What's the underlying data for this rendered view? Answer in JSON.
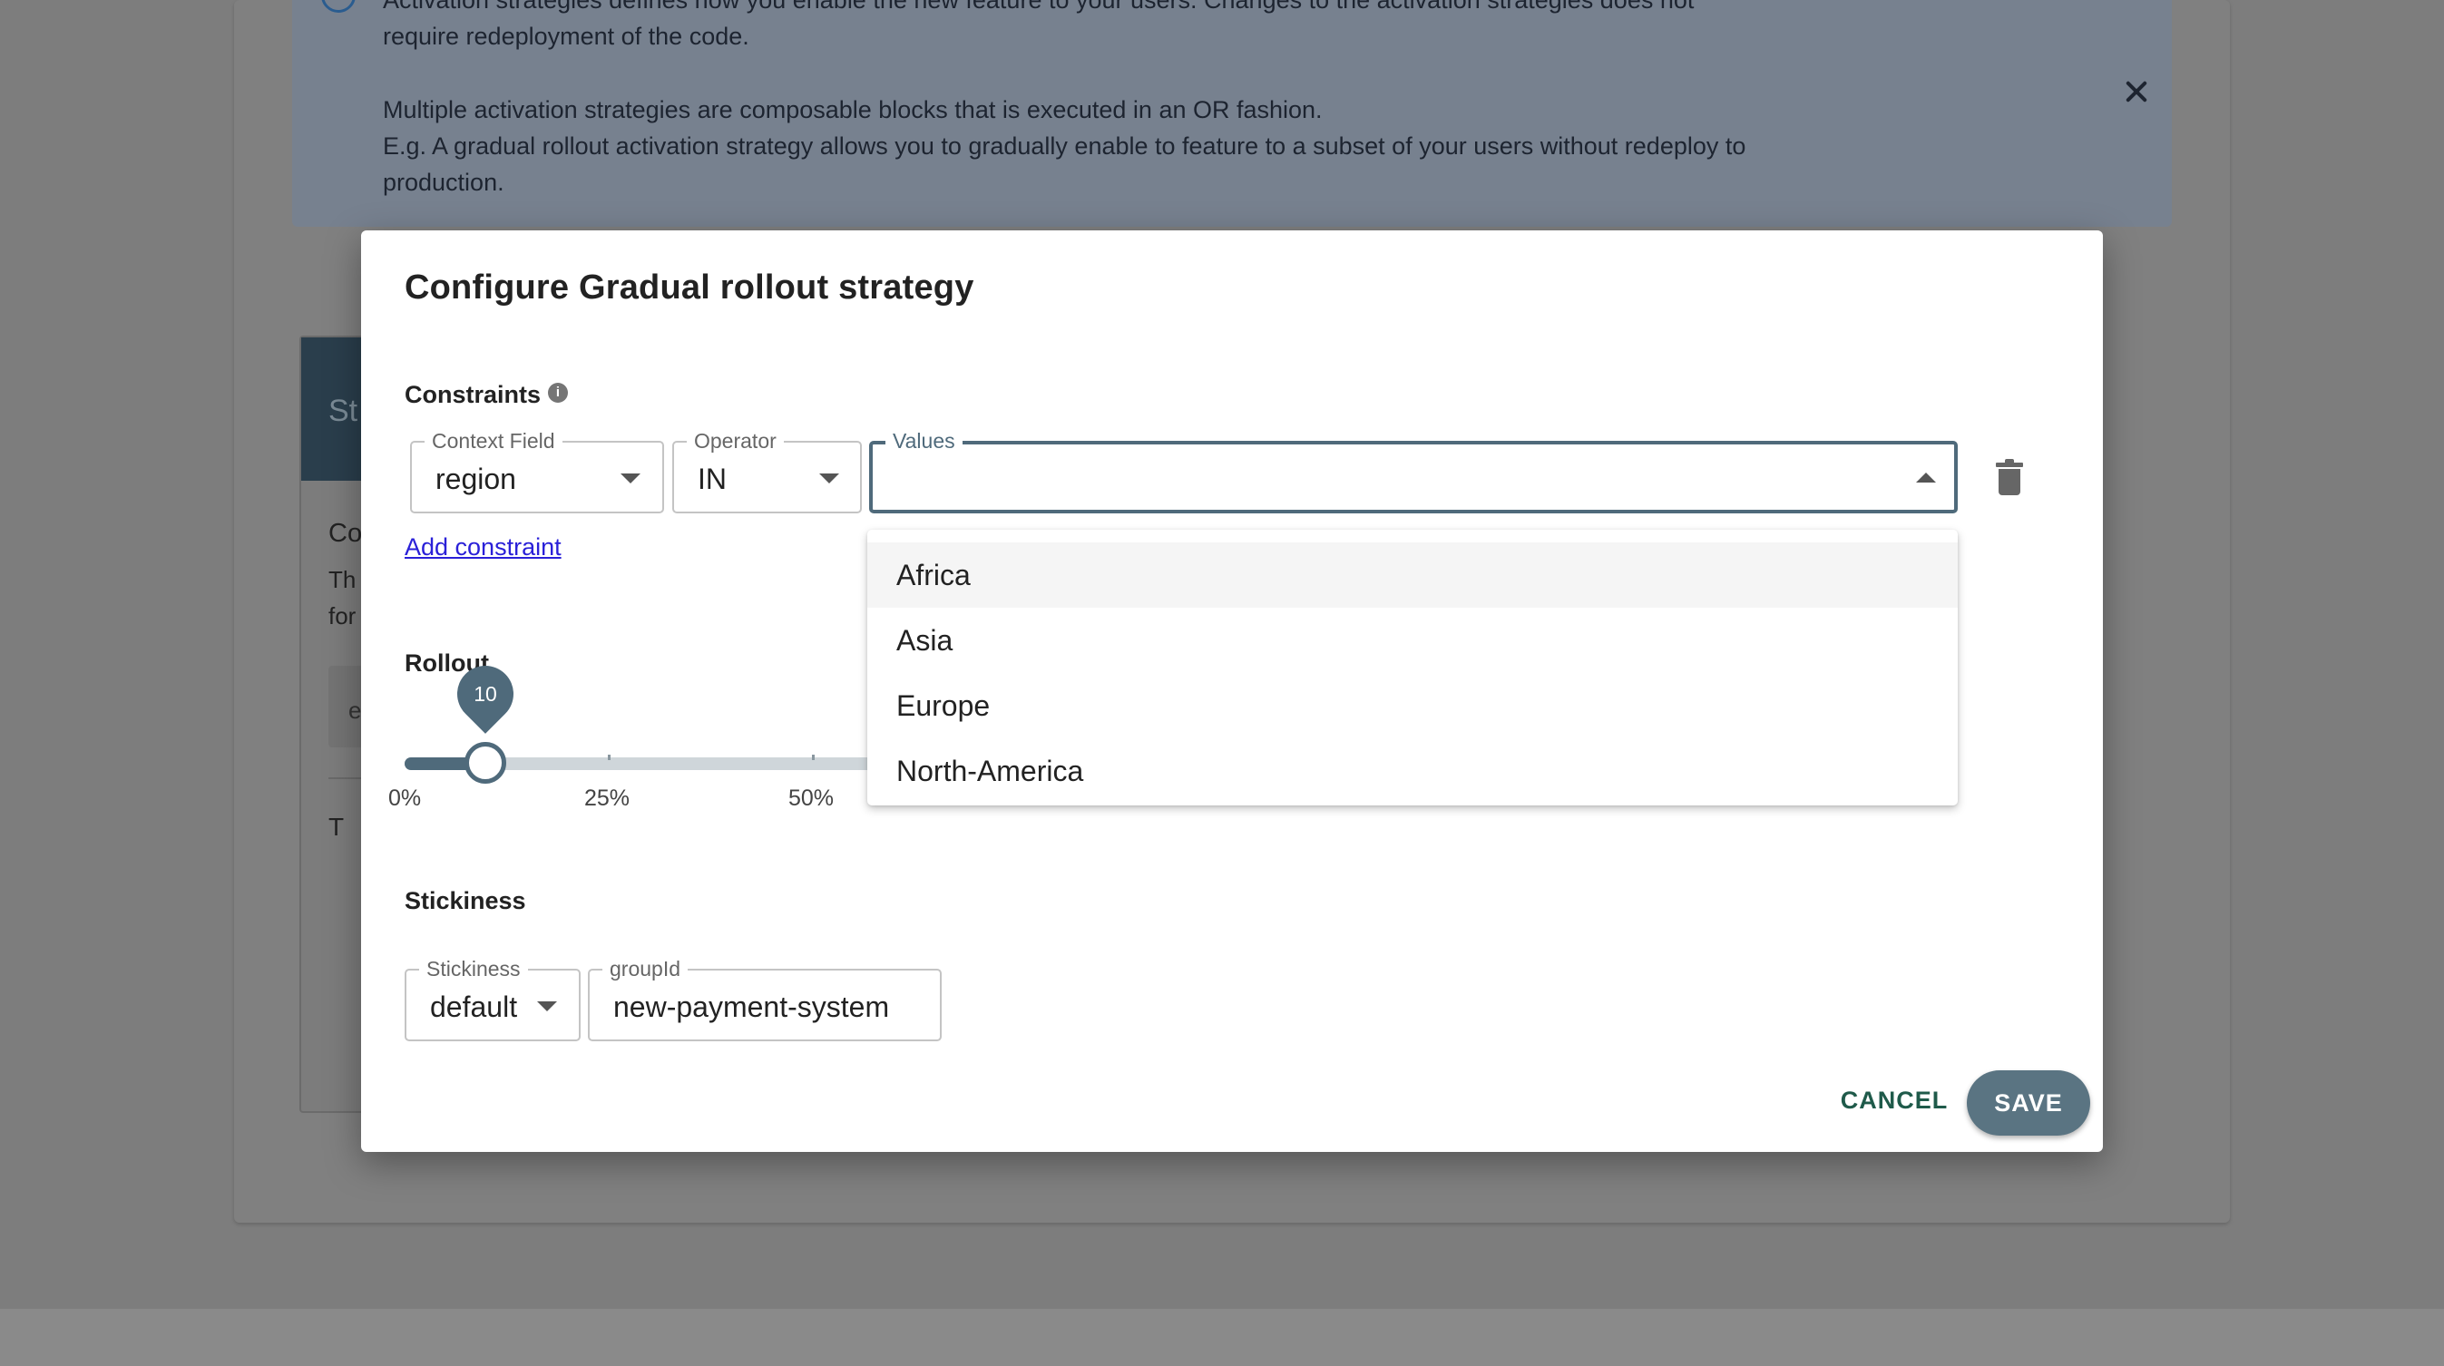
{
  "background": {
    "alert": {
      "line1": "Activation strategies defines how you enable the new feature to your users. Changes to the activation strategies does not",
      "line2": "require redeployment of the code.",
      "line3": "Multiple activation strategies are composable blocks that is executed in an OR fashion.",
      "line4": "E.g. A gradual rollout activation strategy allows you to gradually enable to feature to a subset of your users without redeploy to",
      "line5": "production."
    },
    "strategy_card": {
      "header_partial": "St",
      "title_partial": "Co",
      "text_partial_1": "Th",
      "text_partial_2": "for",
      "input_partial": "e",
      "footer_partial": "T"
    }
  },
  "modal": {
    "title": "Configure Gradual rollout strategy",
    "constraints": {
      "label": "Constraints",
      "help_icon": "i",
      "context_field": {
        "legend": "Context Field",
        "value": "region"
      },
      "operator": {
        "legend": "Operator",
        "value": "IN"
      },
      "values": {
        "legend": "Values",
        "value": ""
      },
      "add_constraint": "Add constraint",
      "options": [
        "Africa",
        "Asia",
        "Europe",
        "North-America"
      ]
    },
    "rollout": {
      "label": "Rollout",
      "value": 10,
      "value_text": "10",
      "tick_labels": [
        "0%",
        "25%",
        "50%"
      ]
    },
    "stickiness": {
      "label": "Stickiness",
      "stickiness_field": {
        "legend": "Stickiness",
        "value": "default"
      },
      "group_id_field": {
        "legend": "groupId",
        "value": "new-payment-system"
      }
    },
    "actions": {
      "cancel": "CANCEL",
      "save": "SAVE"
    }
  },
  "colors": {
    "primary": "#4f6a7b",
    "save_button": "#5a7482",
    "link": "#2a20d8",
    "cancel_text": "#1f5a4a"
  },
  "icons": [
    "info-icon",
    "close-icon",
    "help-icon",
    "chevron-down-icon",
    "chevron-up-icon",
    "trash-icon"
  ]
}
